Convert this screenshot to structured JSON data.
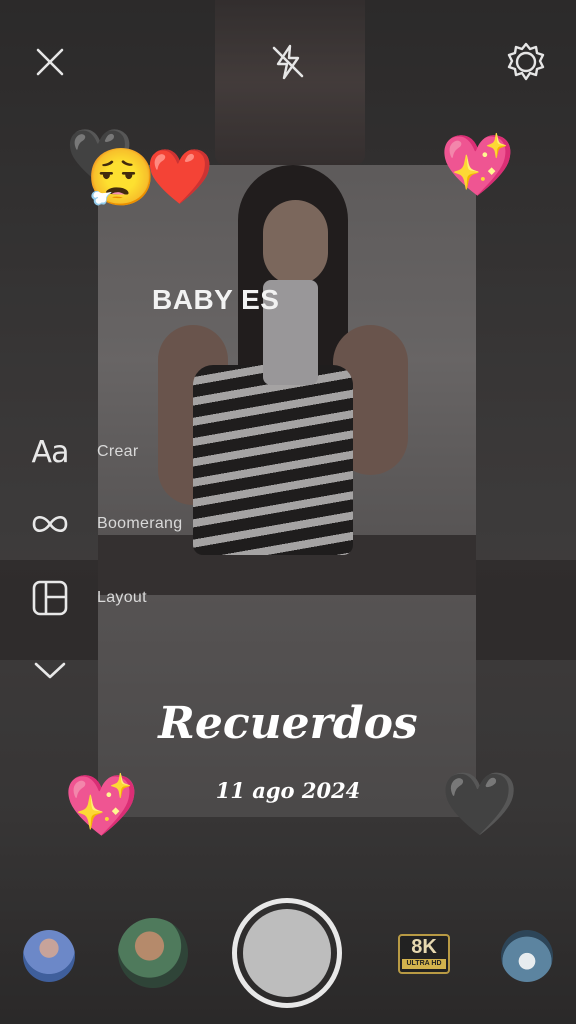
{
  "topbar": {
    "close_icon": "close-icon",
    "flash_icon": "flash-off-icon",
    "settings_icon": "gear-icon"
  },
  "stickers": {
    "heart_black": "🖤",
    "weary_face": "😮‍💨",
    "red_heart": "❤️",
    "sparkling_heart": "💖"
  },
  "overlay_text": "BABY ES",
  "modes": [
    {
      "label": "Crear",
      "icon": "text-aa-icon",
      "glyph": "Aa"
    },
    {
      "label": "Boomerang",
      "icon": "infinity-icon"
    },
    {
      "label": "Layout",
      "icon": "layout-grid-icon"
    },
    {
      "label": "",
      "icon": "chevron-down-icon"
    }
  ],
  "title": {
    "main": "Recuerdos",
    "date": "11 ago 2024"
  },
  "bottom": {
    "badge_main": "8K",
    "badge_sub": "ULTRA HD",
    "shutter_color": "#bdbdbd"
  },
  "colors": {
    "text": "#ffffff",
    "accent_gold": "#d3b34d"
  }
}
